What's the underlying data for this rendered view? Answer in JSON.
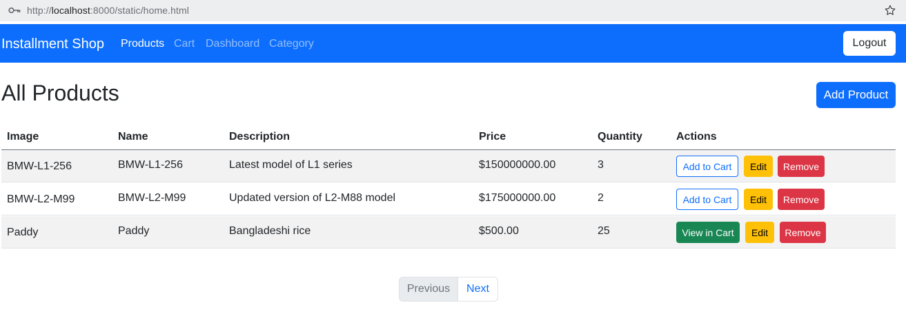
{
  "browser": {
    "url_prefix": "http://",
    "url_host": "localhost",
    "url_rest": ":8000/static/home.html"
  },
  "navbar": {
    "brand": "Installment Shop",
    "links": [
      "Products",
      "Cart",
      "Dashboard",
      "Category"
    ],
    "logout": "Logout",
    "color": "#0d6efd"
  },
  "main": {
    "title": "All Products",
    "add_product": "Add Product"
  },
  "table": {
    "headers": [
      "Image",
      "Name",
      "Description",
      "Price",
      "Quantity",
      "Actions"
    ],
    "rows": [
      {
        "image": "BMW-L1-256",
        "name": "BMW-L1-256",
        "description": "Latest model of L1 series",
        "price": "$150000000.00",
        "quantity": "3",
        "cart_action": "Add to Cart",
        "edit": "Edit",
        "remove": "Remove"
      },
      {
        "image": "BMW-L2-M99",
        "name": "BMW-L2-M99",
        "description": "Updated version of L2-M88 model",
        "price": "$175000000.00",
        "quantity": "2",
        "cart_action": "Add to Cart",
        "edit": "Edit",
        "remove": "Remove"
      },
      {
        "image": "Paddy",
        "name": "Paddy",
        "description": "Bangladeshi rice",
        "price": "$500.00",
        "quantity": "25",
        "cart_action": "View in Cart",
        "edit": "Edit",
        "remove": "Remove"
      }
    ]
  },
  "pagination": {
    "previous": "Previous",
    "next": "Next"
  }
}
